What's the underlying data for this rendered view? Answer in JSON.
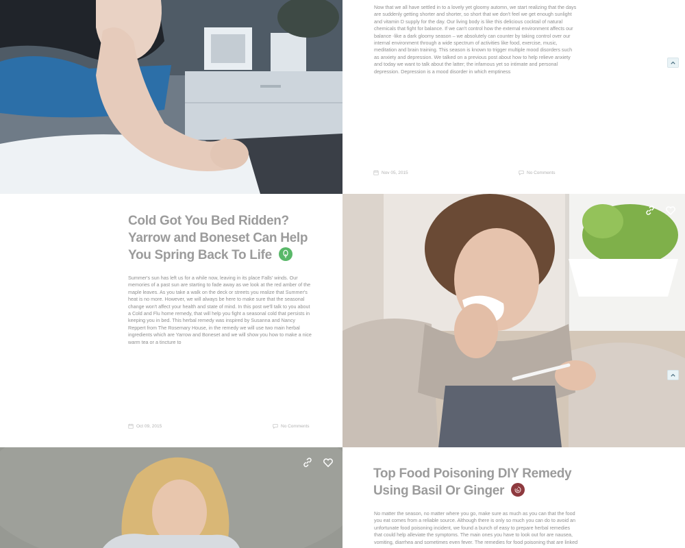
{
  "posts": [
    {
      "excerpt": "Now that we all have settled in to a lovely yet gloomy automn, we start realizing that the days are suddenly getting shorter and shorter, so short that we don't feel we get enough sunlight and vitamin D supply for the day. Our living body is like this delicious cocktail of natural chemicals that fight for balance. If we can't control how the external environment affects our balance -like a dark gloomy season – we absolutely can counter by taking control over our internal environment through a wide spectrum of activities like food, exercise, music, meditation and brain training. This season is known to trigger multiple mood disorders such as anxiety and depression. We talked on a previous post about how to help relieve anxiety and today we want to talk about the latter; the infamous yet so intimate and personal depression. Depression is a mood disorder in which emptiness",
      "date": "Nov 05, 2015",
      "comments": "No Comments"
    },
    {
      "title": "Cold Got You Bed Ridden? Yarrow and Boneset Can Help You Spring Back To Life",
      "category_icon": "tree-icon",
      "category_color": "#59b869",
      "excerpt": "Summer's sun has left us for a while now, leaving in its place Falls' winds. Our memories of a past sun are starting to fade away as we look at the red amber of the maple leaves. As you take a walk on the deck or streets you realize that Summer's heat is no more. However, we will always be here to make sure that the seasonal change won't affect your health and state of mind. In this post we'll talk to  you about a Cold and Flu home remedy, that will help you fight a seasonal cold that persists in keeping you in bed. This herbal remedy was inspired by Susanna and Nancy Reppert from The Rosemary House, in the remedy we will use two main herbal ingredients which are Yarrow and Boneset and we will show you how to make a nice warm tea or a tincture to",
      "date": "Oct 09, 2015",
      "comments": "No Comments"
    },
    {
      "title": "Top Food Poisoning DIY Remedy Using Basil Or Ginger",
      "category_icon": "swirl-icon",
      "category_color": "#8e3a3f",
      "excerpt": "No matter the season, no matter where you go, make sure as much as you can that the food you eat comes from a reliable source. Although there is only so much you can do to avoid an unfortunate food poisoning incident, we found a bunch of easy to prepare herbal remedies that could help alleviate the symptoms. The main ones you have to look out for are nausea, vomiting, diarrhea and sometimes even fever. The remedies for food poisoning that are linked"
    }
  ],
  "icons": {
    "calendar": "calendar-icon",
    "comment": "comment-icon",
    "link": "link-icon",
    "heart": "heart-icon",
    "scroll_top": "chevron-up-icon"
  },
  "colors": {
    "title": "#9b9b9b",
    "body_text": "#8f8f8f",
    "meta_text": "#b2b2b2",
    "scroll_top_bg": "#e9f3f6"
  }
}
